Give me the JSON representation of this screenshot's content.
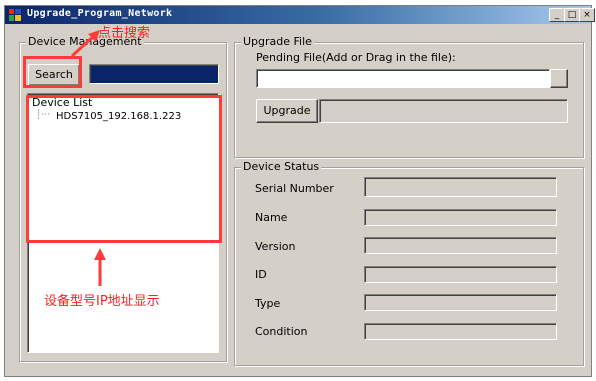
{
  "window": {
    "title": "Upgrade_Program_Network",
    "minimize": "_",
    "maximize": "□",
    "close": "×"
  },
  "device_management": {
    "label": "Device Management",
    "search_button": "Search",
    "device_list_label": "Device List",
    "devices": [
      "HDS7105_192.168.1.223"
    ]
  },
  "upgrade_file": {
    "label": "Upgrade File",
    "pending_label": "Pending File(Add or Drag in the file):",
    "pending_value": "",
    "upgrade_button": "Upgrade"
  },
  "device_status": {
    "label": "Device Status",
    "fields": [
      {
        "label": "Serial Number",
        "value": ""
      },
      {
        "label": "Name",
        "value": ""
      },
      {
        "label": "Version",
        "value": ""
      },
      {
        "label": "ID",
        "value": ""
      },
      {
        "label": "Type",
        "value": ""
      },
      {
        "label": "Condition",
        "value": ""
      }
    ]
  },
  "annotations": {
    "search_hint": "点击搜索",
    "list_hint": "设备型号IP地址显示",
    "color": "#ff2020"
  }
}
